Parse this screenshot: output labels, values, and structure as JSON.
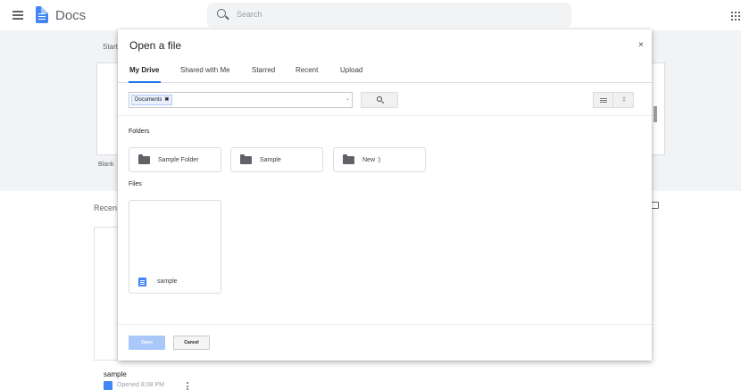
{
  "app": {
    "title": "Docs",
    "search_placeholder": "Search"
  },
  "background": {
    "start_label": "Start",
    "blank_label": "Blank",
    "recent_label": "Recen",
    "doc": {
      "name": "sample",
      "opened": "Opened 8:08 PM"
    }
  },
  "dialog": {
    "title": "Open a file",
    "close_glyph": "×",
    "tabs": [
      {
        "label": "My Drive",
        "active": true
      },
      {
        "label": "Shared with Me",
        "active": false
      },
      {
        "label": "Starred",
        "active": false
      },
      {
        "label": "Recent",
        "active": false
      },
      {
        "label": "Upload",
        "active": false
      }
    ],
    "filter": {
      "chip_label": "Documents",
      "chip_remove": "✖",
      "caret": "⌄"
    },
    "view_sort_glyph": "⇳",
    "folders_label": "Folders",
    "folders": [
      {
        "name": "Sample Folder"
      },
      {
        "name": "Sample"
      },
      {
        "name": "New :)"
      }
    ],
    "files_label": "Files",
    "files": [
      {
        "name": "sample"
      }
    ],
    "buttons": {
      "open": "Open",
      "cancel": "Cancel"
    }
  },
  "colors": {
    "accent": "#1a73e8",
    "doc_blue": "#4285f4",
    "open_disabled": "#a9c8f9"
  }
}
